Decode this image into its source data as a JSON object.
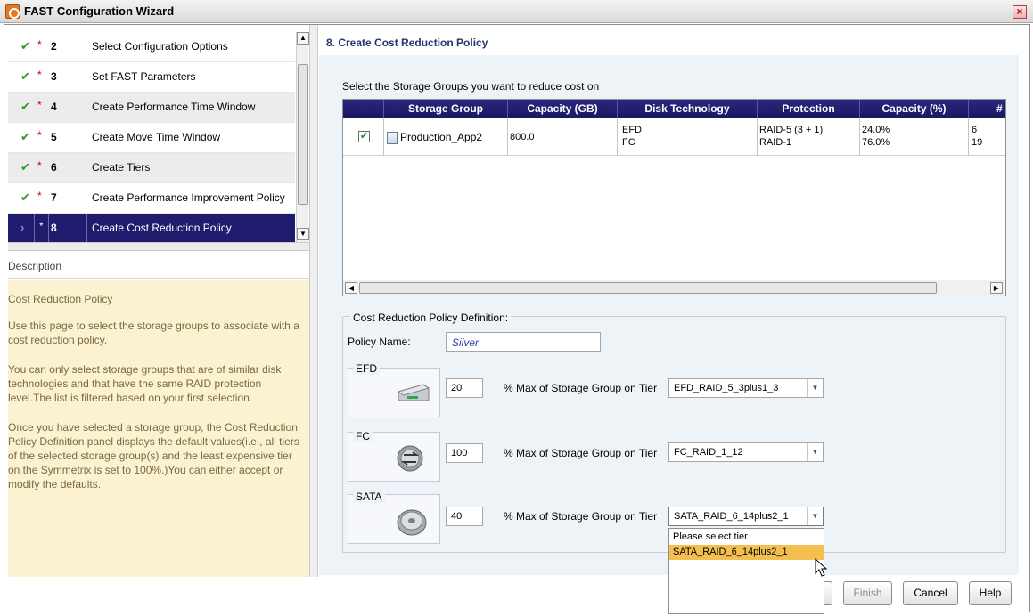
{
  "window": {
    "title": "FAST Configuration Wizard",
    "close_glyph": "×"
  },
  "steps": [
    {
      "num": "2",
      "label": "Select Configuration Options",
      "done": true,
      "required": true
    },
    {
      "num": "3",
      "label": "Set FAST Parameters",
      "done": true,
      "required": true
    },
    {
      "num": "4",
      "label": "Create Performance Time Window",
      "done": true,
      "required": true
    },
    {
      "num": "5",
      "label": "Create Move Time Window",
      "done": true,
      "required": true
    },
    {
      "num": "6",
      "label": "Create Tiers",
      "done": true,
      "required": true
    },
    {
      "num": "7",
      "label": "Create Performance Improvement Policy",
      "done": true,
      "required": true
    },
    {
      "num": "8",
      "label": "Create Cost Reduction Policy",
      "done": false,
      "required": true,
      "selected": true
    }
  ],
  "step_marks": {
    "check": "✔",
    "required": "*",
    "current": "›"
  },
  "description": {
    "heading": "Description",
    "title": "Cost Reduction Policy",
    "paragraphs": [
      "Use this page to select the storage groups to associate with a cost reduction policy.",
      "You can only select storage groups that are of similar disk technologies and that have the same RAID protection level.The list is filtered based on your first selection.",
      "Once you have selected a storage group, the Cost Reduction Policy Definition panel displays the default values(i.e., all tiers of the selected storage group(s) and the least expensive tier on the Symmetrix is set to 100%.)You can either accept or modify the defaults."
    ]
  },
  "page": {
    "title": "8. Create Cost Reduction Policy",
    "table_caption": "Select the Storage Groups you want to reduce cost on"
  },
  "table": {
    "columns": [
      "Storage Group",
      "Capacity (GB)",
      "Disk Technology",
      "Protection",
      "Capacity (%)",
      "#"
    ],
    "rows": [
      {
        "checked": true,
        "storage_group": "Production_App2",
        "capacity_gb": "800.0",
        "disk_technology": [
          "EFD",
          "FC"
        ],
        "protection": [
          "RAID-5 (3 + 1)",
          "RAID-1"
        ],
        "capacity_pct": [
          "24.0%",
          "76.0%"
        ],
        "count": [
          "6",
          "19"
        ]
      }
    ]
  },
  "policy": {
    "section_label": "Cost Reduction Policy Definition:",
    "name_label": "Policy Name:",
    "name_value": "Silver",
    "pct_suffix": "% Max of Storage Group on Tier",
    "tiers": [
      {
        "name": "EFD",
        "percent": "20",
        "selected_tier": "EFD_RAID_5_3plus1_3",
        "icon": "ssd-drive-icon"
      },
      {
        "name": "FC",
        "percent": "100",
        "selected_tier": "FC_RAID_1_12",
        "icon": "fc-disk-icon"
      },
      {
        "name": "SATA",
        "percent": "40",
        "selected_tier": "SATA_RAID_6_14plus2_1",
        "icon": "sata-disk-icon"
      }
    ],
    "sata_dropdown_options": [
      "Please select tier",
      "SATA_RAID_6_14plus2_1"
    ],
    "sata_dropdown_highlighted": "SATA_RAID_6_14plus2_1"
  },
  "buttons": {
    "finish": "Finish",
    "cancel": "Cancel",
    "help": "Help"
  },
  "colors": {
    "header_navy": "#1f1c6e",
    "title_text": "#24356c",
    "description_bg": "#fbf2d2",
    "highlight": "#f3c04f",
    "check_green": "#2e9a2e",
    "required_red": "#d00000"
  }
}
